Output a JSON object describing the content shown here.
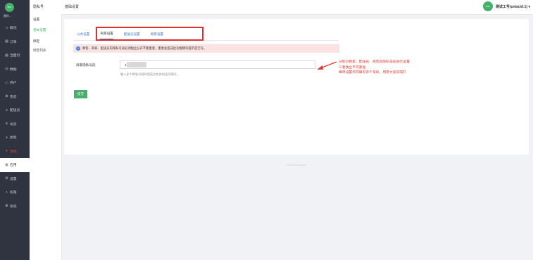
{
  "sidebar": {
    "logo_text": "WIN",
    "subtitle": "删除...",
    "items": [
      {
        "icon": "□",
        "icon_name": "dashboard-icon",
        "label": "概况"
      },
      {
        "icon": "▤",
        "icon_name": "order-icon",
        "label": "订单"
      },
      {
        "icon": "▤",
        "icon_name": "delivery-icon",
        "label": "当面付"
      },
      {
        "icon": "◎",
        "icon_name": "data-icon",
        "label": "数据"
      },
      {
        "icon": "▭",
        "icon_name": "merchant-icon",
        "label": "商户"
      },
      {
        "icon": "⊕",
        "icon_name": "goods-icon",
        "label": "售后"
      },
      {
        "icon": "ᴀ",
        "icon_name": "rider-icon",
        "label": "配送员"
      },
      {
        "icon": "♙",
        "icon_name": "user-icon",
        "label": "访员"
      },
      {
        "icon": "ᴀ",
        "icon_name": "customer-icon",
        "label": "顾客"
      },
      {
        "icon": "♦",
        "icon_name": "marketing-icon",
        "label": "营销"
      },
      {
        "icon": "⊞",
        "icon_name": "apps-icon",
        "label": "应用"
      },
      {
        "icon": "⚙",
        "icon_name": "settings-icon",
        "label": "设置"
      },
      {
        "icon": "⛬",
        "icon_name": "permission-icon",
        "label": "权限"
      },
      {
        "icon": "⊗",
        "icon_name": "system-icon",
        "label": "系统"
      }
    ]
  },
  "subnav": {
    "title": "隐私号",
    "section1": "设置",
    "item1": "基本设置",
    "section2": "绑定",
    "item2": "绑定列表"
  },
  "topbar": {
    "breadcrumb": "基础设置",
    "avatar_text": "WIN",
    "user": "测试工号(uniacid:1) ▾"
  },
  "tabs": [
    "公共设置",
    "商家设置",
    "配送员设置",
    "顾客设置"
  ],
  "active_tab_index": 1,
  "notice": "顾客、商家、配送员的隐私号段必须独立分开不能重复，重复会造成往功能模块提示是空号。",
  "form": {
    "label": "商家隐私号段",
    "value": "170             34",
    "hint": "输入多个隐私号段时用英文状态的逗号隔开。",
    "submit": "提交"
  },
  "annotation": {
    "line1": "分别对商家、配送员、顾客的隐私号段进行设置",
    "line2": "三者独立不可重复",
    "line3": "每项设置均可填写多个号段，用英文逗号隔开"
  },
  "footer": "<<<<<<<<<<<<>>",
  "colors": {
    "sidebar_bg": "#2f3440",
    "accent_green": "#45b06c",
    "link_blue": "#3b77c4",
    "highlight_red": "#e02f2f",
    "notice_bg": "#fbe3e3"
  }
}
